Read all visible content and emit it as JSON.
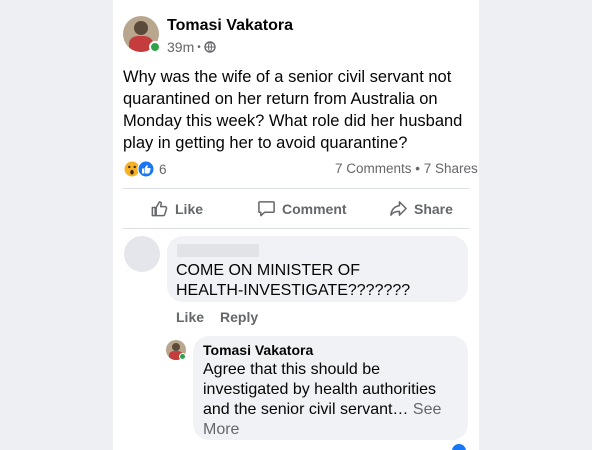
{
  "post": {
    "author": "Tomasi Vakatora",
    "time": "39m",
    "separator": "•",
    "text": "Why was the wife of a senior civil servant not quarantined on her return from Australia on Monday this  week? What role did her husband play in getting her to avoid quarantine?",
    "reaction_count": "6",
    "comments_shares": "7 Comments • 7 Shares"
  },
  "actions": {
    "like": "Like",
    "comment": "Comment",
    "share": "Share"
  },
  "comments": [
    {
      "text": "COME ON MINISTER OF HEALTH-INVESTIGATE???????",
      "like": "Like",
      "reply": "Reply"
    }
  ],
  "reply": {
    "author": "Tomasi Vakatora",
    "text": "Agree that this should be investigated by health authorities and the senior civil servant…",
    "see_more": "See More"
  },
  "colors": {
    "like_blue": "#1877f2",
    "online_green": "#31a24c",
    "bubble_gray": "#f0f2f5"
  },
  "icons": [
    "globe-icon",
    "wow-reaction-icon",
    "like-reaction-icon",
    "thumbs-up-icon",
    "comment-icon",
    "share-icon"
  ]
}
